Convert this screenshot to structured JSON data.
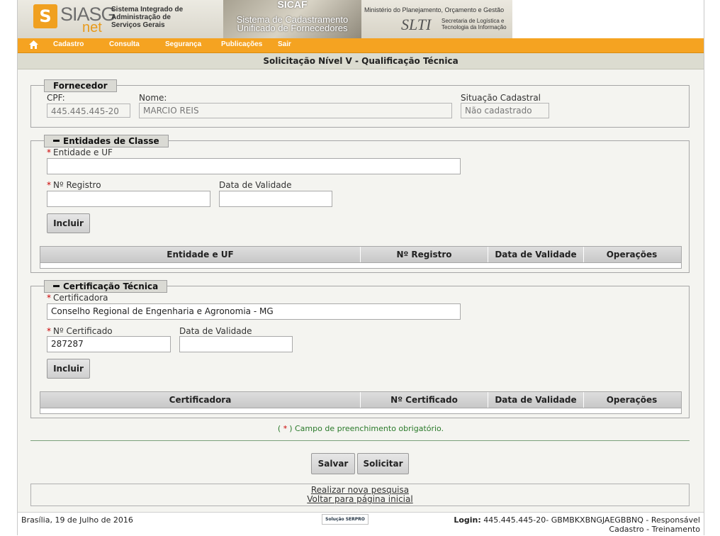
{
  "header": {
    "logo_text": "SIASG",
    "logo_sub": "net",
    "system_desc": [
      "Sistema Integrado de",
      "Administração de",
      "Serviços Gerais"
    ],
    "sicaf_title": "SICAF",
    "sicaf_sub": [
      "Sistema de Cadastramento",
      "Unificado de Fornecedores"
    ],
    "ministry": "Ministério do Planejamento, Orçamento e Gestão",
    "slti": "SLTI",
    "slti_desc": [
      "Secretaria de Logística e",
      "Tecnologia da Informação"
    ]
  },
  "nav": {
    "home_icon": "home-icon",
    "items": [
      "Cadastro",
      "Consulta",
      "Segurança",
      "Publicações",
      "Sair"
    ]
  },
  "page_title": "Solicitação Nível V - Qualificação Técnica",
  "fornecedor": {
    "legend": "Fornecedor",
    "cpf_label": "CPF:",
    "cpf_value": "445.445.445-20",
    "nome_label": "Nome:",
    "nome_value": "MARCIO REIS",
    "situacao_label": "Situação Cadastral",
    "situacao_value": "Não cadastrado"
  },
  "entidades": {
    "legend": "Entidades de Classe",
    "entidade_label": "Entidade e UF",
    "entidade_value": "",
    "registro_label": "Nº Registro",
    "registro_value": "",
    "validade_label": "Data de Validade",
    "validade_value": "",
    "incluir_label": "Incluir",
    "columns": [
      "Entidade e UF",
      "Nº Registro",
      "Data de Validade",
      "Operações"
    ]
  },
  "certificacao": {
    "legend": "Certificação Técnica",
    "certificadora_label": "Certificadora",
    "certificadora_value": "Conselho Regional de Engenharia e Agronomia - MG",
    "certificado_label": "Nº Certificado",
    "certificado_value": "287287",
    "validade_label": "Data de Validade",
    "validade_value": "",
    "incluir_label": "Incluir",
    "columns": [
      "Certificadora",
      "Nº Certificado",
      "Data de Validade",
      "Operações"
    ]
  },
  "required_mark": "*",
  "required_note_open": "(",
  "required_note_text": ") Campo de preenchimento obrigatório.",
  "actions": {
    "salvar": "Salvar",
    "solicitar": "Solicitar"
  },
  "links": {
    "nova_pesquisa": "Realizar nova pesquisa",
    "voltar": "Voltar para página inicial"
  },
  "footer": {
    "date": "Brasília, 19 de Julho de 2016",
    "serpro": "Solução SERPRO",
    "login_label": "Login:",
    "login_value": "445.445.445-20- GBMBKXBNGJAEGBBNQ - Responsável",
    "login_line2": "Cadastro - Treinamento"
  }
}
